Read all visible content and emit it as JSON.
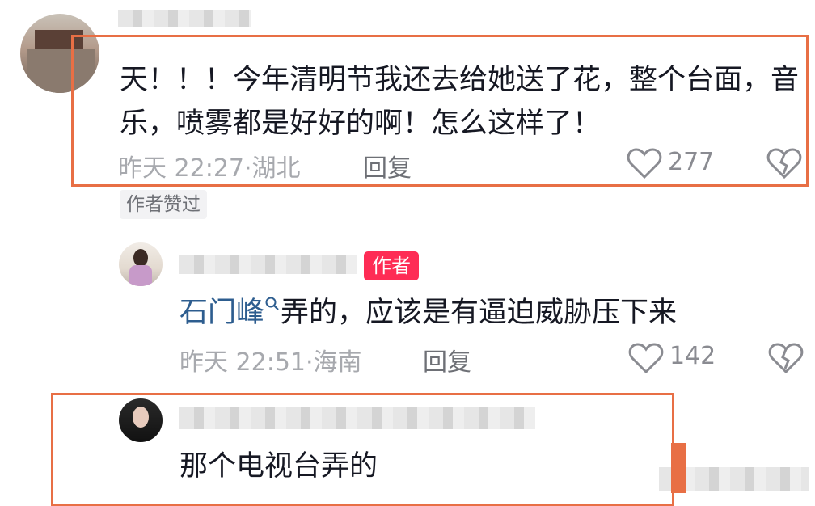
{
  "comments": [
    {
      "text": "天！！！今年清明节我还去给她送了花，整个台面，音乐，喷雾都是好好的啊！怎么这样了！",
      "time": "昨天 22:27",
      "location": "湖北",
      "reply_label": "回复",
      "likes": "277",
      "author_liked_badge": "作者赞过"
    },
    {
      "author_badge": "作者",
      "mention": "石门峰",
      "text": "弄的，应该是有逼迫威胁压下来",
      "time": "昨天 22:51",
      "location": "海南",
      "reply_label": "回复",
      "likes": "142"
    },
    {
      "text": "那个电视台弄的"
    }
  ],
  "colors": {
    "highlight_box": "#e86f45",
    "author_badge": "#fe2c55",
    "mention": "#2d5d8f"
  },
  "icons": [
    "heart-outline-icon",
    "broken-heart-icon",
    "search-icon"
  ]
}
